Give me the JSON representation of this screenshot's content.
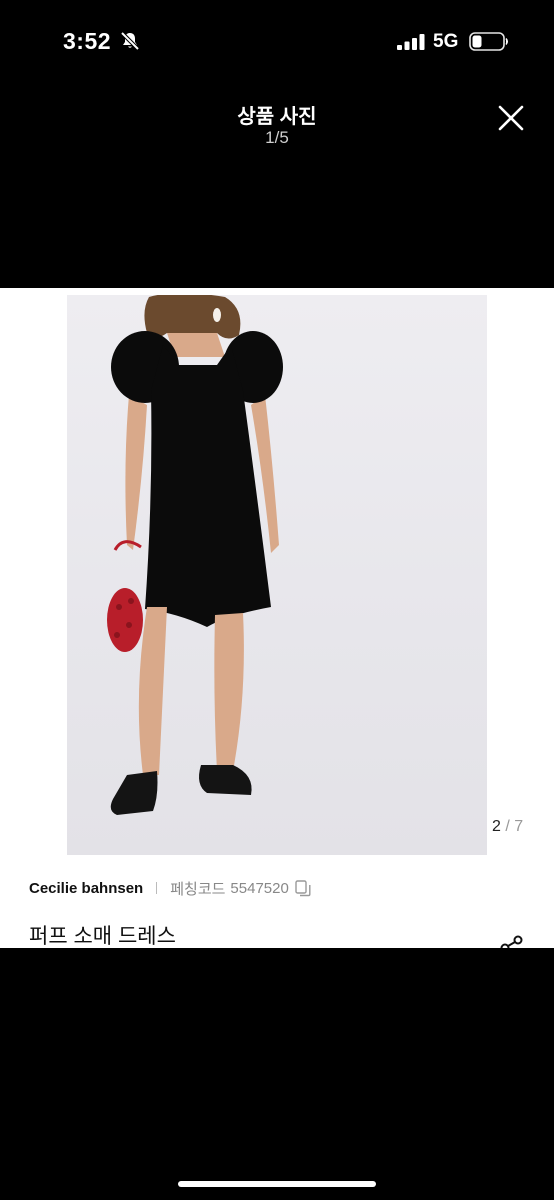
{
  "status_bar": {
    "time": "3:52",
    "network": "5G",
    "icons": [
      "bell-slash-icon",
      "signal-icon",
      "battery-icon"
    ]
  },
  "header": {
    "title": "상품 사진",
    "page_counter": "1/5",
    "close_icon": "close-icon"
  },
  "photo": {
    "image_counter": {
      "current": "2",
      "separator": "/",
      "total": "7"
    }
  },
  "product": {
    "brand": "Cecilie bahnsen",
    "code_label": "페칭코드",
    "code_value": "5547520",
    "title": "퍼프 소매 드레스"
  },
  "colors": {
    "background": "#000000",
    "card": "#ffffff",
    "muted_text": "#888888"
  }
}
